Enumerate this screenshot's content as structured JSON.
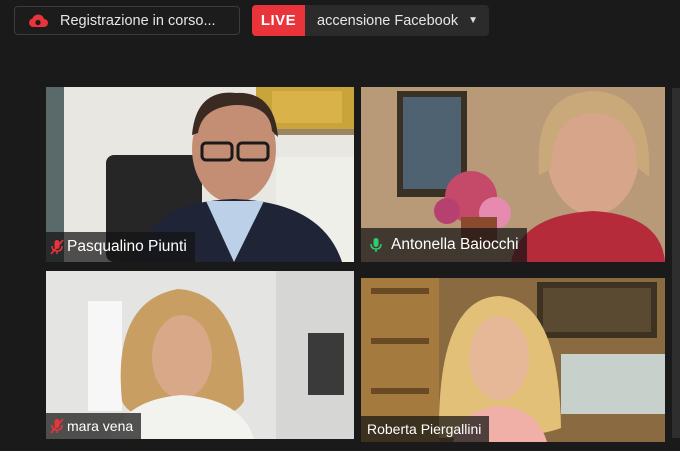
{
  "topbar": {
    "recording_label": "Registrazione in corso...",
    "live_badge": "LIVE",
    "live_status": "accensione Facebook"
  },
  "participants": [
    {
      "name": "Pasqualino Piunti",
      "mic": "muted"
    },
    {
      "name": "Antonella Baiocchi",
      "mic": "active"
    },
    {
      "name": "mara vena",
      "mic": "muted"
    },
    {
      "name": "Roberta Piergallini",
      "mic": "none"
    }
  ],
  "icons": {
    "recording": "cloud-icon",
    "live_dropdown": "chevron-down-icon",
    "muted_mic": "mic-muted-icon",
    "active_mic": "mic-icon"
  },
  "colors": {
    "live_red": "#e8343a",
    "mic_muted": "#e8343a",
    "mic_active": "#2ecc71",
    "background": "#1a1a1a"
  }
}
